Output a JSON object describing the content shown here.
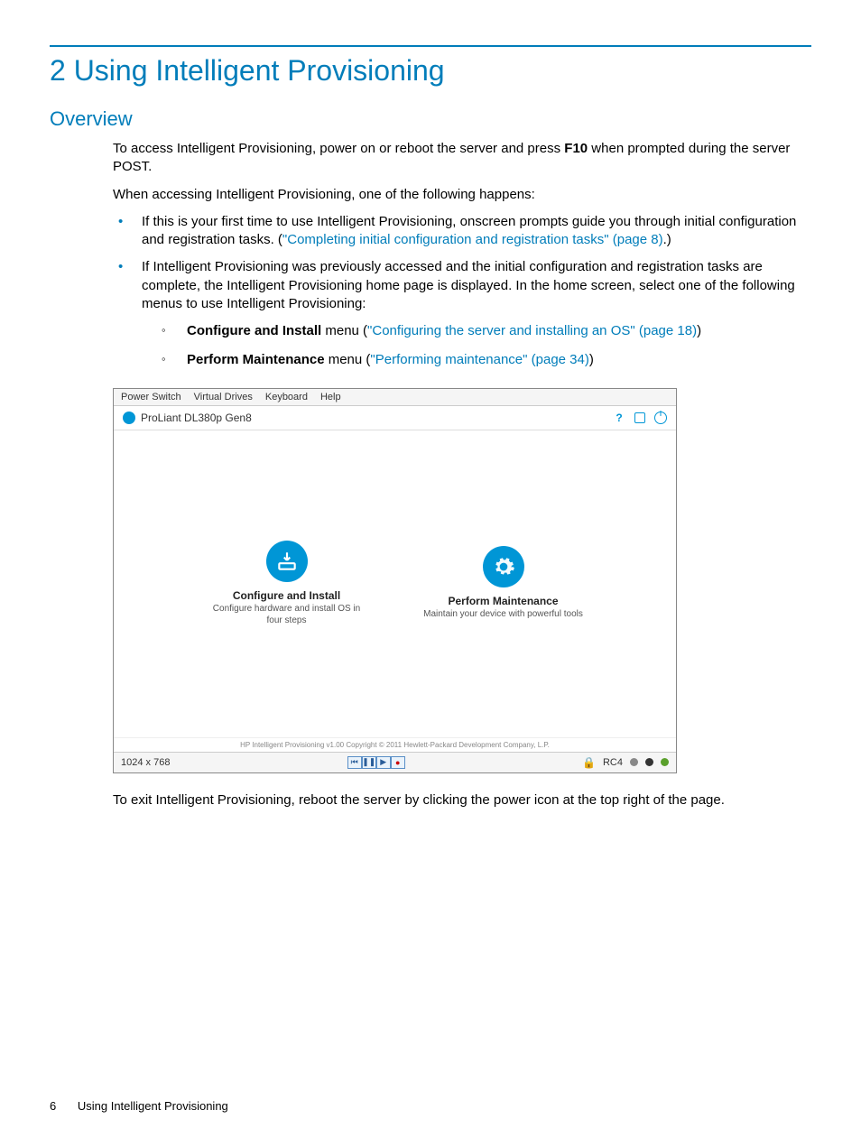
{
  "chapter_title": "2 Using Intelligent Provisioning",
  "section_title": "Overview",
  "para1_a": "To access Intelligent Provisioning, power on or reboot the server and press ",
  "para1_key": "F10",
  "para1_b": " when prompted during the server POST.",
  "para2": "When accessing Intelligent Provisioning, one of the following happens:",
  "bullet1_a": "If this is your first time to use Intelligent Provisioning, onscreen prompts guide you through initial configuration and registration tasks. (",
  "bullet1_link": "\"Completing initial configuration and registration tasks\" (page 8)",
  "bullet1_b": ".)",
  "bullet2": "If Intelligent Provisioning was previously accessed and the initial configuration and registration tasks are complete, the Intelligent Provisioning home page is displayed. In the home screen, select one of the following menus to use Intelligent Provisioning:",
  "sub1_bold": "Configure and Install",
  "sub1_mid": " menu (",
  "sub1_link": "\"Configuring the server and installing an OS\" (page 18)",
  "sub1_end": ")",
  "sub2_bold": "Perform Maintenance",
  "sub2_mid": " menu (",
  "sub2_link": "\"Performing maintenance\" (page 34)",
  "sub2_end": ")",
  "shot": {
    "menu": {
      "m1": "Power Switch",
      "m2": "Virtual Drives",
      "m3": "Keyboard",
      "m4": "Help"
    },
    "title": "ProLiant DL380p Gen8",
    "tile1_title": "Configure and Install",
    "tile1_desc": "Configure hardware and install OS in four steps",
    "tile2_title": "Perform Maintenance",
    "tile2_desc": "Maintain your device with powerful tools",
    "copyright": "HP Intelligent Provisioning v1.00 Copyright © 2011 Hewlett-Packard Development Company, L.P.",
    "resolution": "1024 x 768",
    "rc": "RC4"
  },
  "para3": "To exit Intelligent Provisioning, reboot the server by clicking the power icon at the top right of the page.",
  "footer": {
    "page": "6",
    "title": "Using Intelligent Provisioning"
  }
}
